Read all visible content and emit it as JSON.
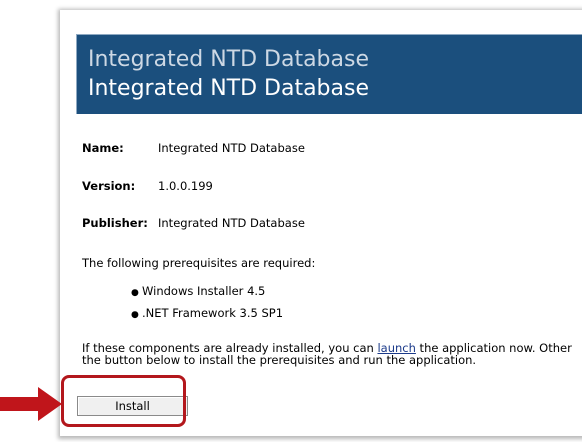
{
  "header": {
    "title_line1": "Integrated NTD Database",
    "title_line2": "Integrated NTD Database"
  },
  "fields": [
    {
      "label": "Name:",
      "value": "Integrated NTD Database"
    },
    {
      "label": "Version:",
      "value": "1.0.0.199"
    },
    {
      "label": "Publisher:",
      "value": "Integrated NTD Database"
    }
  ],
  "prerequisites": {
    "intro": "The following prerequisites are required:",
    "items": [
      "Windows Installer 4.5",
      ".NET Framework 3.5 SP1"
    ]
  },
  "launch_text": {
    "before": "If these components are already installed, you can ",
    "link": "launch",
    "after": " the application now. Other",
    "line2": "the button below to install the prerequisites and run the application."
  },
  "install_button": {
    "label": "Install"
  },
  "annotation": {
    "arrow_icon": "arrow-right-icon",
    "arrow_color": "#c0151b",
    "highlight_color": "#b3171c"
  },
  "colors": {
    "header_bg": "#1b4f7d",
    "header_text_muted": "#cdd8e4",
    "header_text": "#ffffff",
    "link": "#1b3a8a"
  }
}
